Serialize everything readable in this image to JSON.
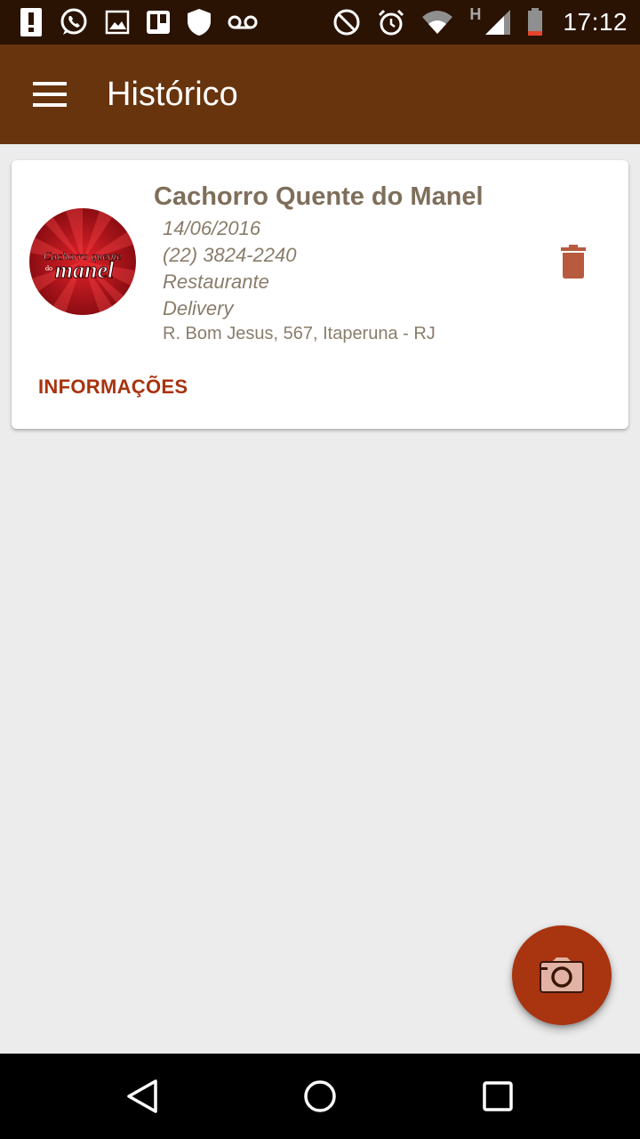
{
  "status_bar": {
    "time": "17:12",
    "network_label": "H",
    "icons": [
      "alert-icon",
      "whatsapp-icon",
      "image-icon",
      "trello-icon",
      "shield-icon",
      "voicemail-icon",
      "do-not-disturb-icon",
      "alarm-icon",
      "wifi-icon",
      "signal-icon",
      "battery-icon"
    ]
  },
  "app_bar": {
    "title": "Histórico",
    "menu_icon": "hamburger-menu-icon"
  },
  "history": {
    "items": [
      {
        "name": "Cachorro Quente do Manel",
        "date": "14/06/2016",
        "phone": "(22) 3824-2240",
        "category": "Restaurante",
        "service": "Delivery",
        "address": "R. Bom Jesus, 567, Itaperuna - RJ",
        "info_label": "INFORMAÇÕES",
        "logo": {
          "line1": "Cachorro quente",
          "line2": "manel",
          "small": "do"
        }
      }
    ]
  },
  "fab": {
    "icon": "camera-icon"
  },
  "nav_bar": {
    "icons": [
      "back-icon",
      "home-icon",
      "recents-icon"
    ]
  },
  "colors": {
    "status_bar": "#2a1303",
    "app_bar": "#68340d",
    "accent": "#a8330f",
    "background": "#ececec",
    "card_text": "#7e6e5a"
  }
}
